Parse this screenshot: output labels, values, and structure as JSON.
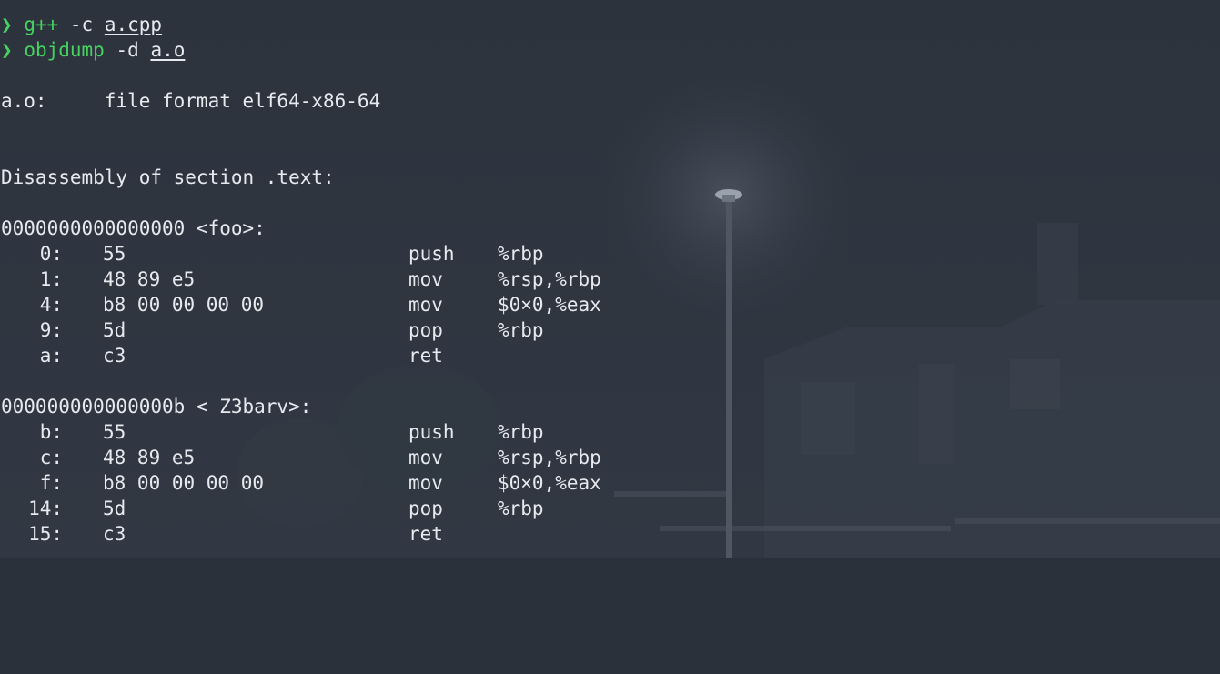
{
  "terminal": {
    "commands": [
      {
        "prompt": "❯",
        "command": "g++",
        "args": "-c",
        "path": "a.cpp"
      },
      {
        "prompt": "❯",
        "command": "objdump",
        "args": "-d",
        "path": "a.o"
      }
    ],
    "file_line": "a.o:     file format elf64-x86-64",
    "section_line": "Disassembly of section .text:",
    "functions": [
      {
        "header": "0000000000000000 <foo>:",
        "instructions": [
          {
            "offset": "0:",
            "bytes": "55",
            "op": "push",
            "args": "%rbp"
          },
          {
            "offset": "1:",
            "bytes": "48 89 e5",
            "op": "mov",
            "args": "%rsp,%rbp"
          },
          {
            "offset": "4:",
            "bytes": "b8 00 00 00 00",
            "op": "mov",
            "args": "$0×0,%eax"
          },
          {
            "offset": "9:",
            "bytes": "5d",
            "op": "pop",
            "args": "%rbp"
          },
          {
            "offset": "a:",
            "bytes": "c3",
            "op": "ret",
            "args": ""
          }
        ]
      },
      {
        "header": "000000000000000b <_Z3barv>:",
        "instructions": [
          {
            "offset": "b:",
            "bytes": "55",
            "op": "push",
            "args": "%rbp"
          },
          {
            "offset": "c:",
            "bytes": "48 89 e5",
            "op": "mov",
            "args": "%rsp,%rbp"
          },
          {
            "offset": "f:",
            "bytes": "b8 00 00 00 00",
            "op": "mov",
            "args": "$0×0,%eax"
          },
          {
            "offset": "14:",
            "bytes": "5d",
            "op": "pop",
            "args": "%rbp"
          },
          {
            "offset": "15:",
            "bytes": "c3",
            "op": "ret",
            "args": ""
          }
        ]
      }
    ]
  },
  "colors": {
    "background": "#2b313b",
    "text": "#e6e9ee",
    "prompt_green": "#44d35f"
  }
}
